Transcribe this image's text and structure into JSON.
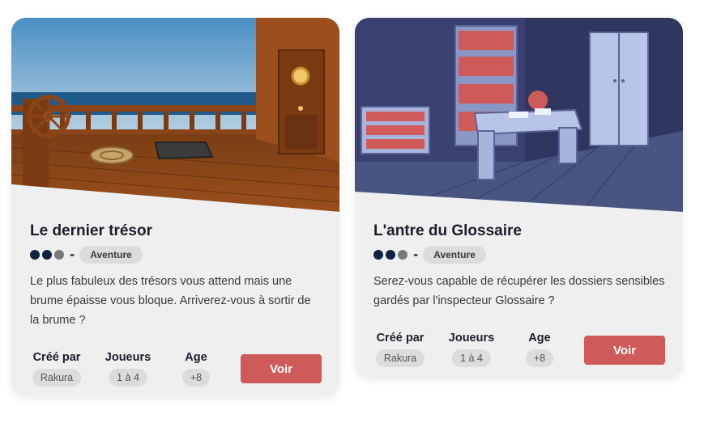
{
  "cards": [
    {
      "title": "Le dernier trésor",
      "difficulty": {
        "level": 2,
        "max": 3
      },
      "genre": "Aventure",
      "description": "Le plus fabuleux des trésors vous attend mais une brume épaisse vous bloque. Arriverez-vous à sortir de la brume ?",
      "creator_label": "Créé par",
      "creator": "Rakura",
      "players_label": "Joueurs",
      "players": "1 à 4",
      "age_label": "Age",
      "age": "+8",
      "button_label": "Voir"
    },
    {
      "title": "L'antre du Glossaire",
      "difficulty": {
        "level": 2,
        "max": 3
      },
      "genre": "Aventure",
      "description": "Serez-vous capable de récupérer les dossiers sensibles gardés par l'inspecteur Glossaire ?",
      "creator_label": "Créé par",
      "creator": "Rakura",
      "players_label": "Joueurs",
      "players": "1 à 4",
      "age_label": "Age",
      "age": "+8",
      "button_label": "Voir"
    }
  ],
  "colors": {
    "dot_filled": "#0f2340",
    "dot_empty": "#7a7a7a",
    "button": "#cf5a5a",
    "card_bg": "#efefef"
  }
}
